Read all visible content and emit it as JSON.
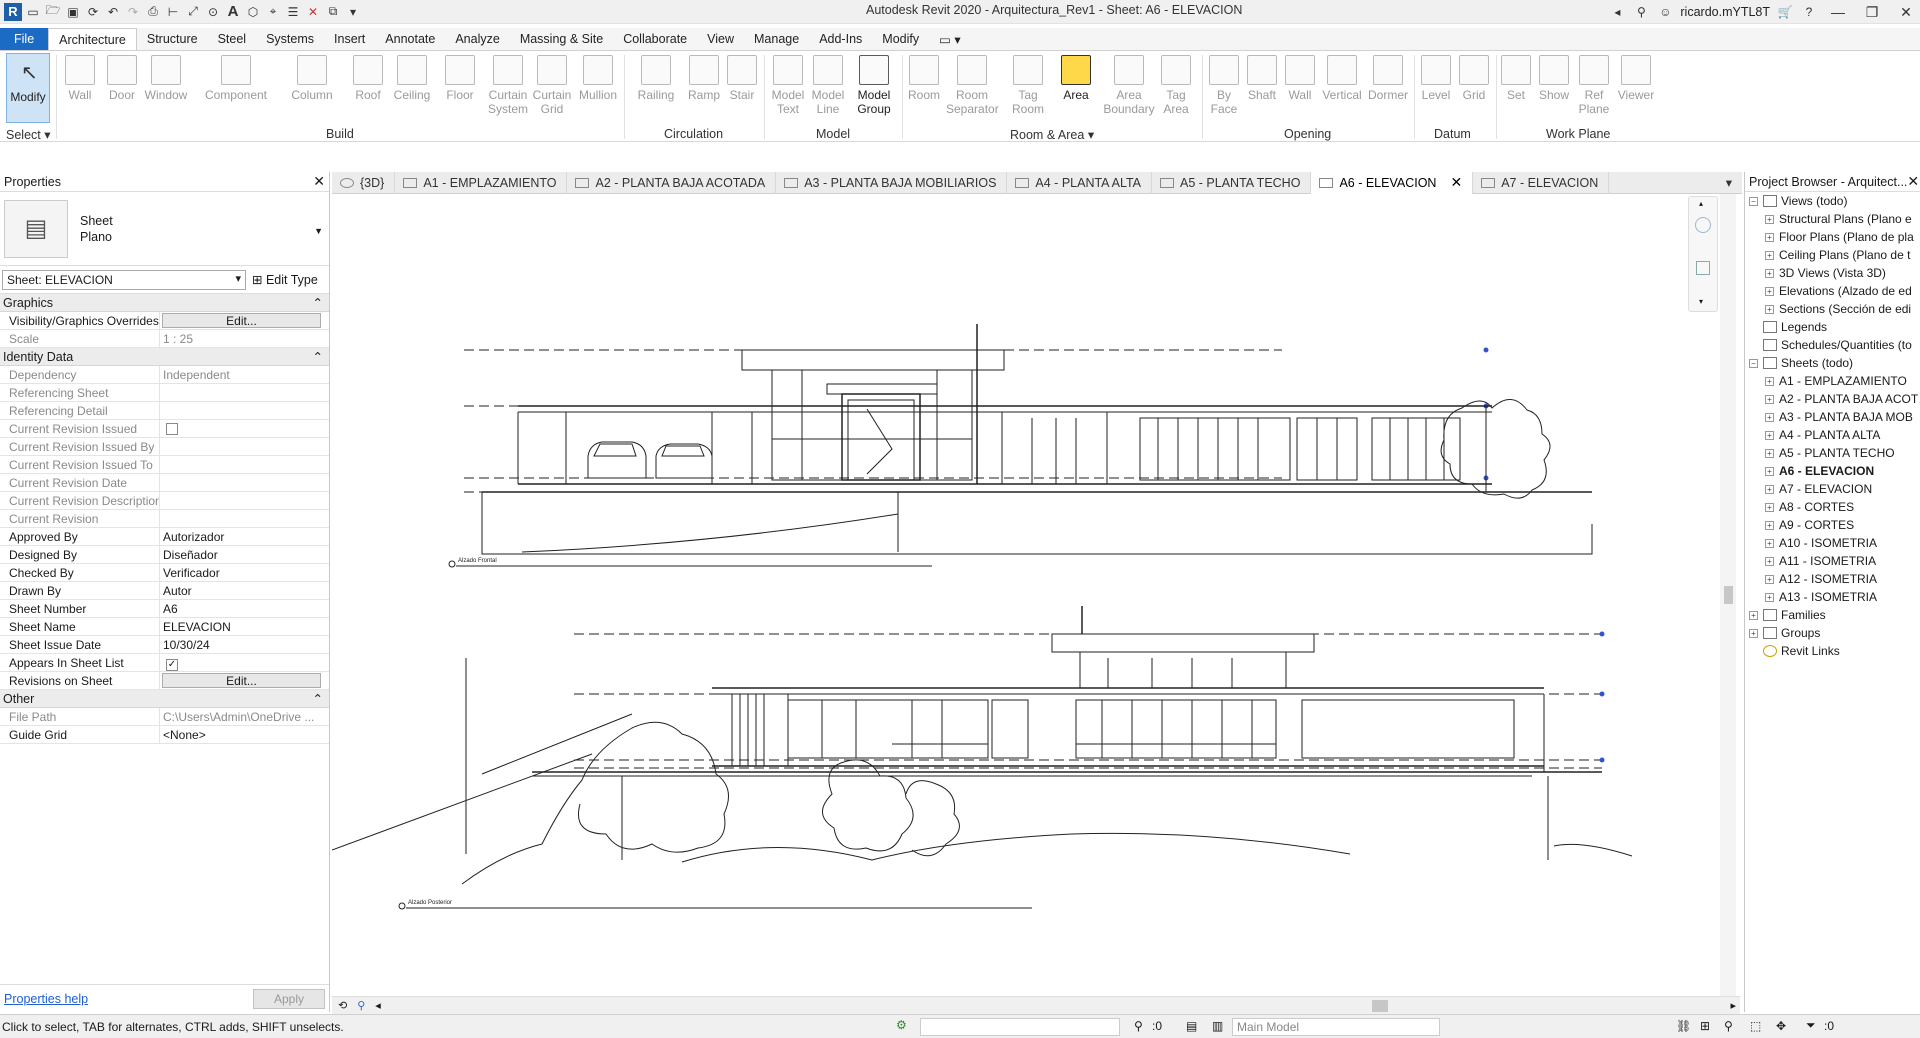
{
  "window": {
    "title": "Autodesk Revit 2020 - Arquitectura_Rev1 - Sheet: A6 - ELEVACION",
    "user": "ricardo.mYTL8T"
  },
  "ribbon": {
    "tabs": [
      "File",
      "Architecture",
      "Structure",
      "Steel",
      "Systems",
      "Insert",
      "Annotate",
      "Analyze",
      "Massing & Site",
      "Collaborate",
      "View",
      "Manage",
      "Add-Ins",
      "Modify"
    ],
    "active_tab": "Architecture",
    "modify": "Modify",
    "select": "Select",
    "tools": {
      "wall": "Wall",
      "door": "Door",
      "window": "Window",
      "component": "Component",
      "column": "Column",
      "roof": "Roof",
      "ceiling": "Ceiling",
      "floor": "Floor",
      "curtain_system_1": "Curtain",
      "curtain_system_2": "System",
      "curtain_grid_1": "Curtain",
      "curtain_grid_2": "Grid",
      "mullion": "Mullion",
      "railing": "Railing",
      "ramp": "Ramp",
      "stair": "Stair",
      "model_text_1": "Model",
      "model_text_2": "Text",
      "model_line_1": "Model",
      "model_line_2": "Line",
      "model_group_1": "Model",
      "model_group_2": "Group",
      "room": "Room",
      "room_sep_1": "Room",
      "room_sep_2": "Separator",
      "tag_room_1": "Tag",
      "tag_room_2": "Room",
      "area": "Area",
      "area_boundary_1": "Area",
      "area_boundary_2": "Boundary",
      "tag_area_1": "Tag",
      "tag_area_2": "Area",
      "by_face_1": "By",
      "by_face_2": "Face",
      "shaft": "Shaft",
      "wall_opening": "Wall",
      "vertical": "Vertical",
      "dormer": "Dormer",
      "level": "Level",
      "grid": "Grid",
      "set": "Set",
      "show": "Show",
      "ref_plane_1": "Ref",
      "ref_plane_2": "Plane",
      "viewer": "Viewer"
    },
    "groups": {
      "build": "Build",
      "circulation": "Circulation",
      "model": "Model",
      "room_area": "Room & Area ▾",
      "opening": "Opening",
      "datum": "Datum",
      "work_plane": "Work Plane"
    }
  },
  "properties": {
    "title": "Properties",
    "type_line1": "Sheet",
    "type_line2": "Plano",
    "selector": "Sheet: ELEVACION",
    "edit_type": "Edit Type",
    "categories": {
      "graphics": "Graphics",
      "identity": "Identity Data",
      "other": "Other"
    },
    "rows": {
      "vis_k": "Visibility/Graphics Overrides",
      "vis_v": "Edit...",
      "scale_k": "Scale",
      "scale_v": "1 : 25",
      "dep_k": "Dependency",
      "dep_v": "Independent",
      "refsheet_k": "Referencing Sheet",
      "refdetail_k": "Referencing Detail",
      "crissued_k": "Current Revision Issued",
      "crissuedby_k": "Current Revision Issued By",
      "crissuedto_k": "Current Revision Issued To",
      "crdate_k": "Current Revision Date",
      "crdesc_k": "Current Revision Description",
      "cr_k": "Current Revision",
      "approved_k": "Approved By",
      "approved_v": "Autorizador",
      "designed_k": "Designed By",
      "designed_v": "Diseñador",
      "checked_k": "Checked By",
      "checked_v": "Verificador",
      "drawn_k": "Drawn By",
      "drawn_v": "Autor",
      "number_k": "Sheet Number",
      "number_v": "A6",
      "name_k": "Sheet Name",
      "name_v": "ELEVACION",
      "date_k": "Sheet Issue Date",
      "date_v": "10/30/24",
      "appears_k": "Appears In Sheet List",
      "revs_k": "Revisions on Sheet",
      "revs_v": "Edit...",
      "path_k": "File Path",
      "path_v": "C:\\Users\\Admin\\OneDrive ...",
      "guide_k": "Guide Grid",
      "guide_v": "<None>"
    },
    "help": "Properties help",
    "apply": "Apply"
  },
  "view_tabs": [
    {
      "label": "{3D}"
    },
    {
      "label": "A1 - EMPLAZAMIENTO"
    },
    {
      "label": "A2 - PLANTA BAJA ACOTADA"
    },
    {
      "label": "A3 - PLANTA BAJA MOBILIARIOS"
    },
    {
      "label": "A4 - PLANTA ALTA"
    },
    {
      "label": "A5 - PLANTA TECHO"
    },
    {
      "label": "A6 - ELEVACION"
    },
    {
      "label": "A7 - ELEVACION"
    }
  ],
  "drawing": {
    "label_top": "Alzado Frontal",
    "label_bottom": "Alzado Posterior"
  },
  "browser": {
    "title": "Project Browser - Arquitect...",
    "views": "Views (todo)",
    "view_items": [
      "Structural Plans (Plano e",
      "Floor Plans (Plano de pla",
      "Ceiling Plans (Plano de t",
      "3D Views (Vista 3D)",
      "Elevations (Alzado de ed",
      "Sections (Sección de edi"
    ],
    "legends": "Legends",
    "schedules": "Schedules/Quantities (to",
    "sheets": "Sheets (todo)",
    "sheet_items": [
      "A1 - EMPLAZAMIENTO",
      "A2 - PLANTA BAJA ACOT",
      "A3 - PLANTA BAJA MOB",
      "A4 - PLANTA ALTA",
      "A5 - PLANTA TECHO",
      "A6 - ELEVACION",
      "A7 - ELEVACION",
      "A8 - CORTES",
      "A9 - CORTES",
      "A10 - ISOMETRIA",
      "A11 - ISOMETRIA",
      "A12 - ISOMETRIA",
      "A13 - ISOMETRIA"
    ],
    "families": "Families",
    "groups": "Groups",
    "links": "Revit Links"
  },
  "status": {
    "hint": "Click to select, TAB for alternates, CTRL adds, SHIFT unselects.",
    "count": ":0",
    "model": "Main Model",
    "filter": ":0"
  }
}
